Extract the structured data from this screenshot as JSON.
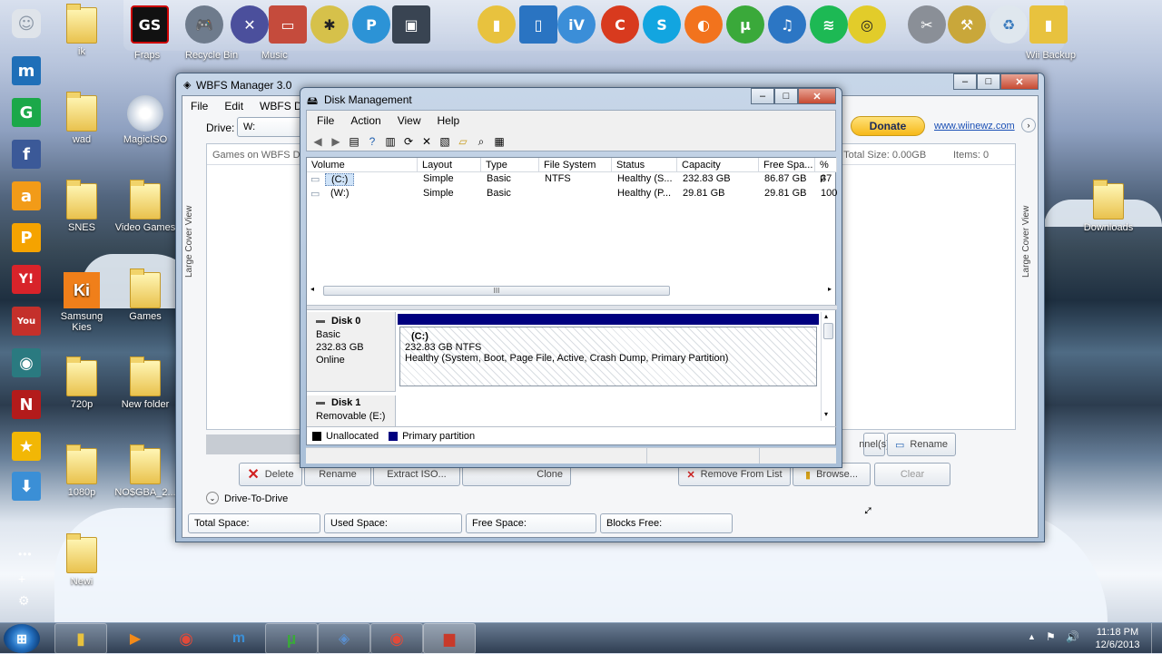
{
  "desktop": {
    "icons": [
      {
        "label": "ik"
      },
      {
        "label": "wad"
      },
      {
        "label": "MagicISO"
      },
      {
        "label": "SNES"
      },
      {
        "label": "Video Games"
      },
      {
        "label": "Samsung Kies"
      },
      {
        "label": "Games"
      },
      {
        "label": "720p"
      },
      {
        "label": "New folder"
      },
      {
        "label": "1080p"
      },
      {
        "label": "NO$GBA_2..."
      },
      {
        "label": "Newi"
      },
      {
        "label": "Downloads"
      }
    ]
  },
  "dock": {
    "labels": [
      "Fraps",
      "Recycle Bin",
      "Music",
      "Wii Backup"
    ]
  },
  "wbfs": {
    "title": "WBFS Manager 3.0",
    "menu": [
      "File",
      "Edit",
      "WBFS Drive"
    ],
    "drive_label": "Drive:",
    "drive_value": "W:",
    "donate": "Donate",
    "link": "www.wiinewz.com",
    "games_label": "Games on WBFS Dr",
    "total_size": "ed Total Size:  0.00GB",
    "items": "Items:   0",
    "side_left": "Large Cover View",
    "side_right": "Large Cover View",
    "buttons": {
      "delete": "Delete",
      "rename": "Rename",
      "extract": "Extract ISO...",
      "clone": "Clone",
      "remove": "Remove From List",
      "browse": "Browse...",
      "clear": "Clear",
      "channels": "nnel(s)",
      "rename2": "Rename"
    },
    "drive_to_drive": "Drive-To-Drive",
    "stats": {
      "total": "Total Space:",
      "used": "Used Space:",
      "free": "Free Space:",
      "blocks": "Blocks Free:"
    }
  },
  "dm": {
    "title": "Disk Management",
    "menu": [
      "File",
      "Action",
      "View",
      "Help"
    ],
    "columns": [
      "Volume",
      "Layout",
      "Type",
      "File System",
      "Status",
      "Capacity",
      "Free Spa...",
      "% F"
    ],
    "rows": [
      {
        "volume": "(C:)",
        "layout": "Simple",
        "type": "Basic",
        "fs": "NTFS",
        "status": "Healthy (S...",
        "capacity": "232.83 GB",
        "free": "86.87 GB",
        "pct": "37"
      },
      {
        "volume": "(W:)",
        "layout": "Simple",
        "type": "Basic",
        "fs": "",
        "status": "Healthy (P...",
        "capacity": "29.81 GB",
        "free": "29.81 GB",
        "pct": "100"
      }
    ],
    "disk0": {
      "name": "Disk 0",
      "kind": "Basic",
      "size": "232.83 GB",
      "state": "Online",
      "part_name": "(C:)",
      "part_size": "232.83 GB NTFS",
      "part_status": "Healthy (System, Boot, Page File, Active, Crash Dump, Primary Partition)"
    },
    "disk1": {
      "name": "Disk 1",
      "kind": "Removable (E:)"
    },
    "legend": [
      "Unallocated",
      "Primary partition"
    ],
    "scroll_mark": "III"
  },
  "taskbar": {
    "time": "11:18 PM",
    "date": "12/6/2013"
  },
  "colors": {
    "primary_partition": "#00007f",
    "unallocated": "#000000"
  }
}
